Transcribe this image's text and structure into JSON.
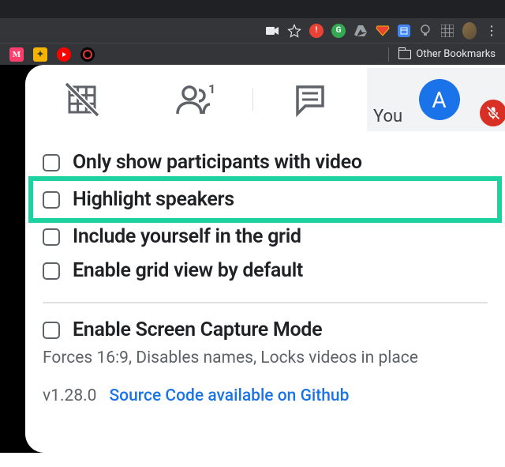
{
  "browser": {
    "other_bookmarks": "Other Bookmarks"
  },
  "meet": {
    "you_label": "You",
    "avatar_letter": "A"
  },
  "options": {
    "only_video": "Only show participants with video",
    "highlight_speakers": "Highlight speakers",
    "include_yourself": "Include yourself in the grid",
    "enable_default": "Enable grid view by default",
    "screen_capture": "Enable Screen Capture Mode",
    "screen_capture_desc": "Forces 16:9, Disables names, Locks videos in place"
  },
  "footer": {
    "version": "v1.28.0",
    "source_link": "Source Code available on Github"
  }
}
